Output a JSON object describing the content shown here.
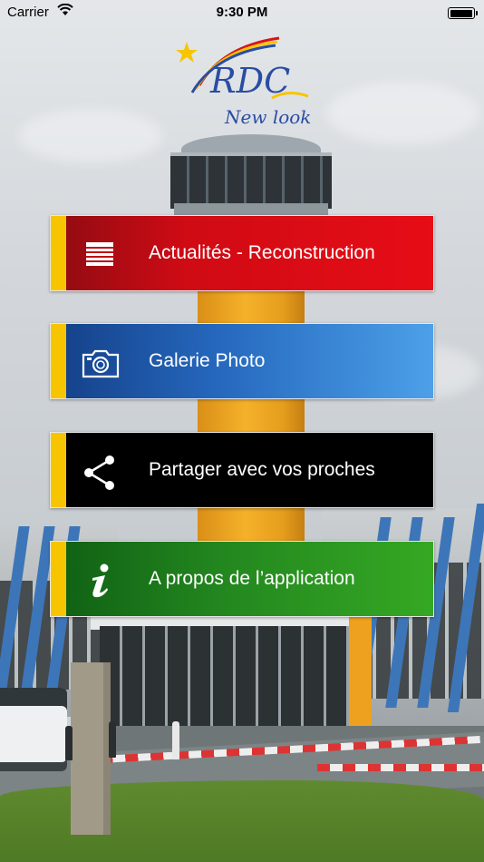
{
  "status_bar": {
    "carrier": "Carrier",
    "time": "9:30 PM",
    "battery_level": 1.0
  },
  "logo": {
    "brand": "RDC",
    "tagline": "New look",
    "colors": {
      "blue": "#2a4da3",
      "yellow": "#f7c500",
      "red": "#d7141a",
      "star": "#f7c500"
    }
  },
  "menu": [
    {
      "label": "Actualités - Reconstruction",
      "icon": "list-icon",
      "color": "#e70c16"
    },
    {
      "label": "Galerie Photo",
      "icon": "camera-icon",
      "color": "#2669bf"
    },
    {
      "label": "Partager avec vos proches",
      "icon": "share-icon",
      "color": "#000000"
    },
    {
      "label": "A propos de l’application",
      "icon": "info-icon",
      "color": "#23871f"
    }
  ],
  "accent_stripe_color": "#f7c500"
}
